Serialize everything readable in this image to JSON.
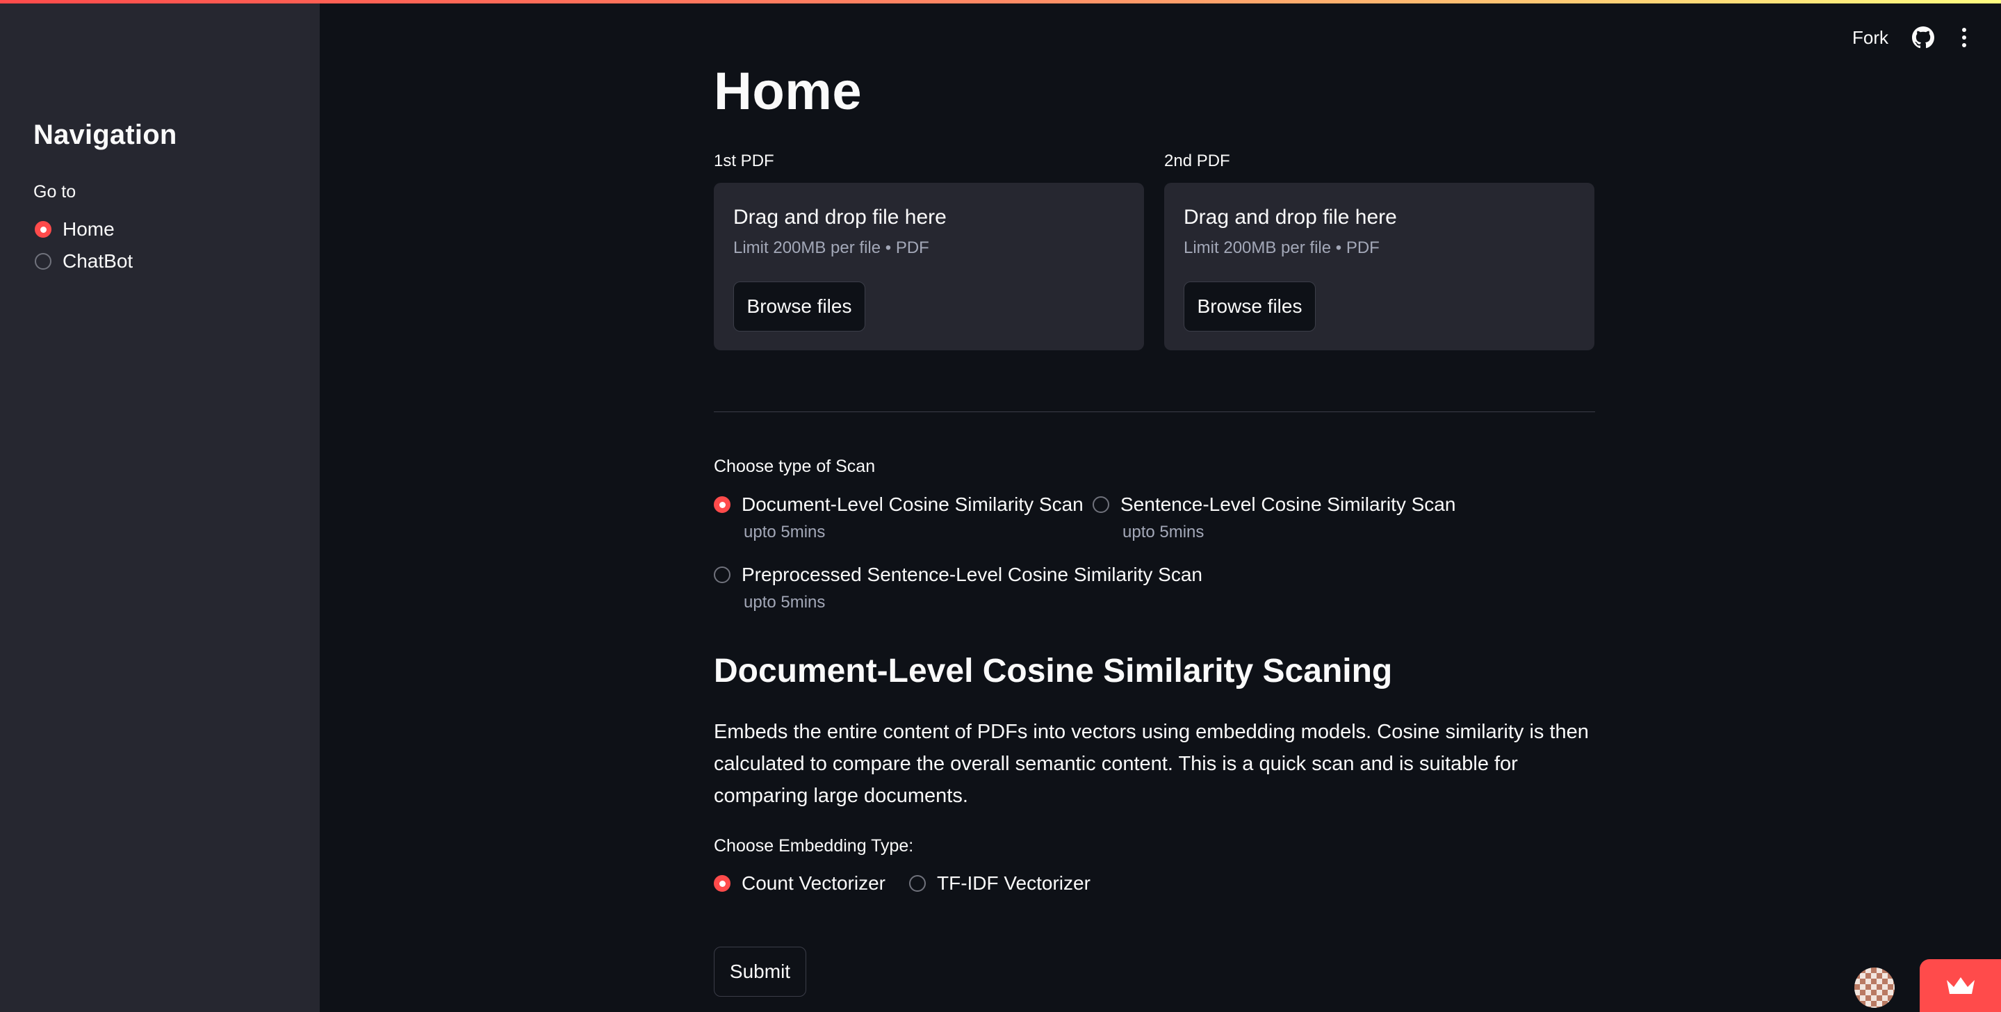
{
  "sidebar": {
    "title": "Navigation",
    "goto_label": "Go to",
    "items": [
      {
        "label": "Home",
        "selected": true
      },
      {
        "label": "ChatBot",
        "selected": false
      }
    ]
  },
  "header": {
    "fork_label": "Fork",
    "github_icon": "github-icon",
    "menu_icon": "kebab-menu-icon"
  },
  "main": {
    "title": "Home",
    "uploaders": [
      {
        "label": "1st PDF",
        "drop_text": "Drag and drop file here",
        "limit_text": "Limit 200MB per file • PDF",
        "button": "Browse files"
      },
      {
        "label": "2nd PDF",
        "drop_text": "Drag and drop file here",
        "limit_text": "Limit 200MB per file • PDF",
        "button": "Browse files"
      }
    ],
    "scan": {
      "label": "Choose type of Scan",
      "options": [
        {
          "label": "Document-Level Cosine Similarity Scan",
          "caption": "upto 5mins",
          "selected": true
        },
        {
          "label": "Sentence-Level Cosine Similarity Scan",
          "caption": "upto 5mins",
          "selected": false
        },
        {
          "label": "Preprocessed Sentence-Level Cosine Similarity Scan",
          "caption": "upto 5mins",
          "selected": false
        }
      ]
    },
    "section_title": "Document-Level Cosine Similarity Scaning",
    "description": "Embeds the entire content of PDFs into vectors using embedding models. Cosine similarity is then calculated to compare the overall semantic content. This is a quick scan and is suitable for comparing large documents.",
    "embedding": {
      "label": "Choose Embedding Type:",
      "options": [
        {
          "label": "Count Vectorizer",
          "selected": true
        },
        {
          "label": "TF-IDF Vectorizer",
          "selected": false
        }
      ]
    },
    "submit_label": "Submit"
  },
  "colors": {
    "accent": "#ff4b4b",
    "background": "#0e1117",
    "sidebar": "#262730"
  }
}
